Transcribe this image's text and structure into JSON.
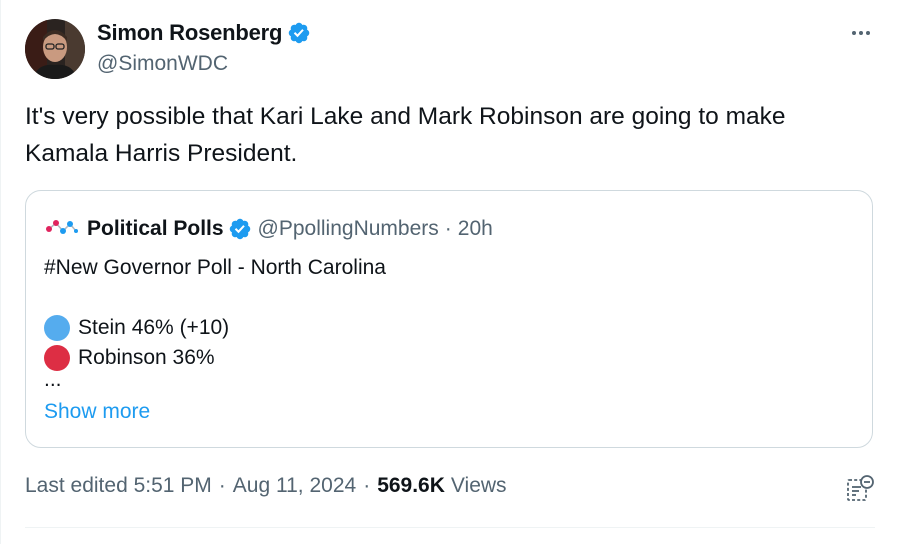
{
  "author": {
    "display_name": "Simon Rosenberg",
    "handle": "@SimonWDC",
    "verified_color": "#1d9bf0"
  },
  "tweet": {
    "text": "It's very possible that Kari Lake and Mark Robinson are going to make Kamala Harris President."
  },
  "quoted": {
    "display_name": "Political Polls",
    "handle": "@PpollingNumbers",
    "separator": "·",
    "time": "20h",
    "line1": "#New Governor Poll - North Carolina",
    "stein": "Stein 46% (+10)",
    "robinson": "Robinson 36%",
    "ellipsis": "...",
    "show_more": "Show more",
    "stein_color": "#55acee",
    "robinson_color": "#dd2e44"
  },
  "meta": {
    "edited": "Last edited 5:51 PM",
    "sep1": "·",
    "date": "Aug 11, 2024",
    "sep2": "·",
    "views_count": "569.6K",
    "views_label": "Views"
  },
  "icons": {
    "more": "more-options-icon",
    "verified": "verified-badge-icon",
    "analytics": "post-analytics-icon"
  }
}
